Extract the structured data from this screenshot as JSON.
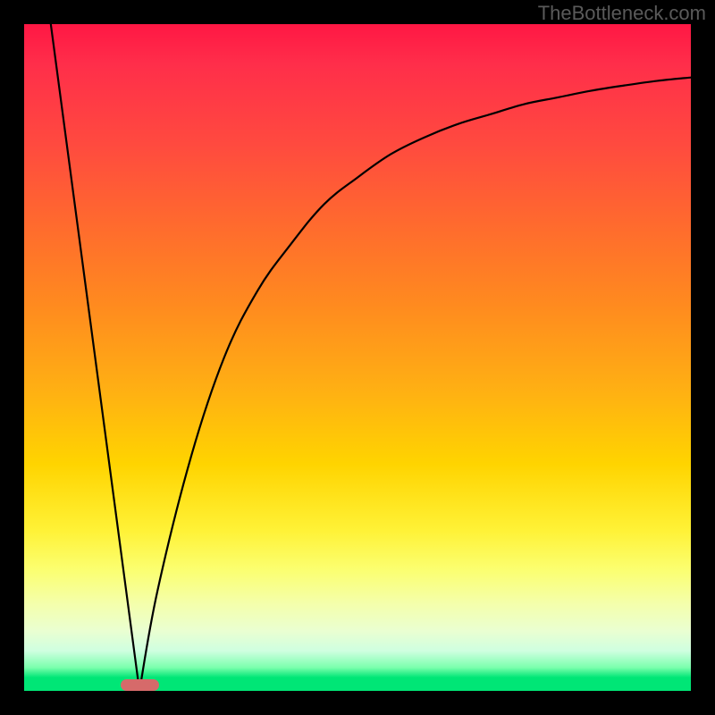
{
  "watermark": "TheBottleneck.com",
  "chart_data": {
    "type": "line",
    "title": "",
    "xlabel": "",
    "ylabel": "",
    "xlim": [
      0,
      100
    ],
    "ylim": [
      0,
      100
    ],
    "grid": false,
    "background": "red-yellow-green vertical gradient",
    "series": [
      {
        "name": "left-slope",
        "x": [
          4,
          17.3
        ],
        "y": [
          100,
          0
        ]
      },
      {
        "name": "right-curve",
        "x": [
          17.3,
          20,
          25,
          30,
          35,
          40,
          45,
          50,
          55,
          60,
          65,
          70,
          75,
          80,
          85,
          90,
          95,
          100
        ],
        "y": [
          0,
          15,
          35,
          50,
          60,
          67,
          73,
          77,
          80.5,
          83,
          85,
          86.5,
          88,
          89,
          90,
          90.8,
          91.5,
          92
        ]
      }
    ],
    "annotations": [
      {
        "name": "minimum-marker",
        "shape": "rounded-rect",
        "x": 17.3,
        "y": 0,
        "color": "#d66a6a"
      }
    ]
  }
}
